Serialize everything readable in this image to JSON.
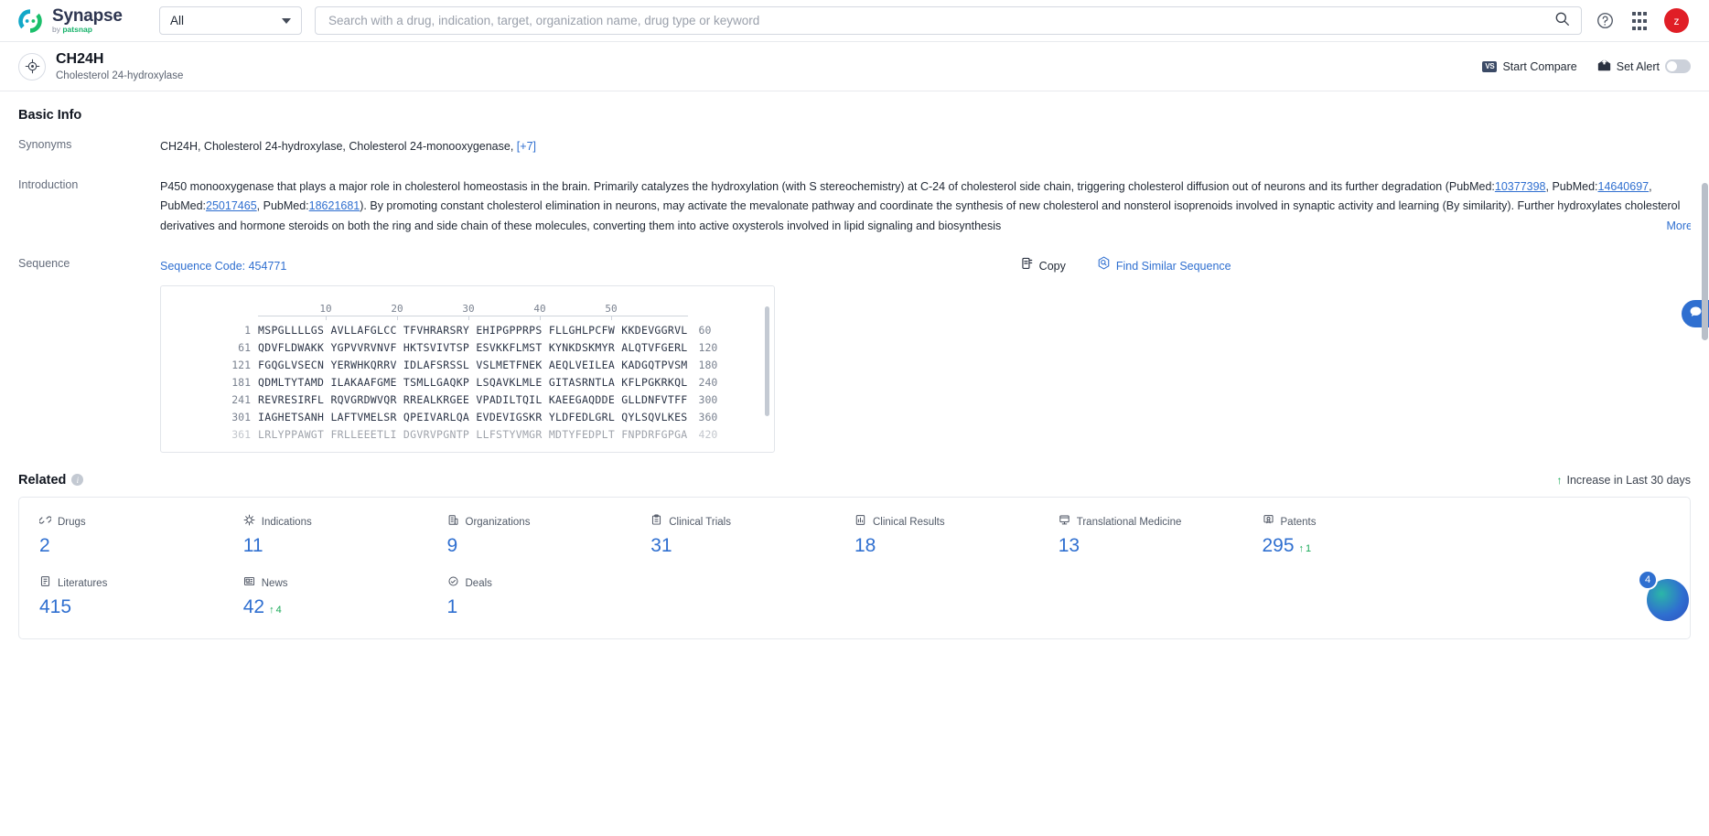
{
  "topbar": {
    "brand_name": "Synapse",
    "brand_sub_prefix": "by ",
    "brand_sub_name": "patsnap",
    "scope_value": "All",
    "search_placeholder": "Search with a drug, indication, target, organization name, drug type or keyword",
    "help_icon": "question-circle-icon",
    "apps_icon": "grid-apps-icon",
    "avatar_initial": "z",
    "accent_color": "#2f6fd0",
    "avatar_color": "#e01e26"
  },
  "entity": {
    "icon": "target-crosshair-icon",
    "name": "CH24H",
    "full_name": "Cholesterol 24-hydroxylase",
    "compare_label": "Start Compare",
    "compare_chip": "VS",
    "alert_label": "Set Alert",
    "alert_enabled": false
  },
  "basic_info": {
    "section_title": "Basic Info",
    "synonyms_label": "Synonyms",
    "synonyms_value": "CH24H,  Cholesterol 24-hydroxylase,  Cholesterol 24-monooxygenase,",
    "synonyms_more": "[+7]",
    "introduction_label": "Introduction",
    "introduction_line1": "P450 monooxygenase that plays a major role in cholesterol homeostasis in the brain. Primarily catalyzes the hydroxylation (with S stereochemistry) at C-24 of cholesterol side chain, triggering cholesterol diffusion out of neurons and its further degradation",
    "intro_l2_a": "(PubMed:",
    "intro_pm1": "10377398",
    "intro_l2_b": ", PubMed:",
    "intro_pm2": "14640697",
    "intro_l2_c": ", PubMed:",
    "intro_pm3": "25017465",
    "intro_l2_d": ", PubMed:",
    "intro_pm4": "18621681",
    "intro_l2_e": "). By promoting constant cholesterol elimination in neurons, may activate the mevalonate pathway and coordinate the synthesis of new cholesterol and nonsterol isoprenoids involved",
    "introduction_line3": "in synaptic activity and learning (By similarity). Further hydroxylates cholesterol derivatives and hormone steroids on both the ring and side chain of these molecules, converting them into active oxysterols involved in lipid signaling and biosynthesis",
    "more_label": "More"
  },
  "sequence": {
    "label": "Sequence",
    "code_label": "Sequence Code: 454771",
    "copy_label": "Copy",
    "copy_icon": "copy-icon",
    "find_similar_label": "Find Similar Sequence",
    "find_similar_icon": "hexagon-search-icon",
    "ruler_ticks": [
      "10",
      "20",
      "30",
      "40",
      "50"
    ],
    "rows": [
      {
        "start": "1",
        "chunks": "MSPGLLLLGS AVLLAFGLCC TFVHRARSRY EHIPGPPRPS FLLGHLPCFW KKDEVGGRVL",
        "end": "60"
      },
      {
        "start": "61",
        "chunks": "QDVFLDWAKK YGPVVRVNVF HKTSVIVTSP ESVKKFLMST KYNKDSKMYR ALQTVFGERL",
        "end": "120"
      },
      {
        "start": "121",
        "chunks": "FGQGLVSECN YERWHKQRRV IDLAFSRSSL VSLMETFNEK AEQLVEILEA KADGQTPVSM",
        "end": "180"
      },
      {
        "start": "181",
        "chunks": "QDMLTYTAMD ILAKAAFGME TSMLLGAQKP LSQAVKLMLE GITASRNTLA KFLPGKRKQL",
        "end": "240"
      },
      {
        "start": "241",
        "chunks": "REVRESIRFL RQVGRDWVQR RREALKRGEE VPADILTQIL KAEEGAQDDE GLLDNFVTFF",
        "end": "300"
      },
      {
        "start": "301",
        "chunks": "IAGHETSANH LAFTVMELSR QPEIVARLQA EVDEVIGSKR YLDFEDLGRL QYLSQVLKES",
        "end": "360"
      },
      {
        "start": "361",
        "chunks": "LRLYPPAWGT FRLLEEETLI DGVRVPGNTP LLFSTYVMGR MDTYFEDPLT FNPDRFGPGA",
        "end": "420"
      }
    ]
  },
  "related": {
    "title": "Related",
    "info_icon": "info-icon",
    "increase_note": "Increase in Last 30 days",
    "increase_icon": "arrow-up-icon",
    "items": [
      {
        "label": "Drugs",
        "icon": "pill-link-icon",
        "value": "2",
        "delta": null
      },
      {
        "label": "Indications",
        "icon": "virus-icon",
        "value": "11",
        "delta": null
      },
      {
        "label": "Organizations",
        "icon": "building-icon",
        "value": "9",
        "delta": null
      },
      {
        "label": "Clinical Trials",
        "icon": "clipboard-icon",
        "value": "31",
        "delta": null
      },
      {
        "label": "Clinical Results",
        "icon": "chart-doc-icon",
        "value": "18",
        "delta": null
      },
      {
        "label": "Translational Medicine",
        "icon": "microscope-icon",
        "value": "13",
        "delta": null
      },
      {
        "label": "Patents",
        "icon": "certificate-icon",
        "value": "295",
        "delta": "1"
      },
      {
        "label": "Literatures",
        "icon": "book-icon",
        "value": "415",
        "delta": null
      },
      {
        "label": "News",
        "icon": "news-icon",
        "value": "42",
        "delta": "4"
      },
      {
        "label": "Deals",
        "icon": "handshake-icon",
        "value": "1",
        "delta": null
      }
    ]
  },
  "floating": {
    "side_chip_icon": "chat-bubble-icon",
    "fab_badge": "4",
    "fab_icon": "assistant-orb-icon"
  }
}
